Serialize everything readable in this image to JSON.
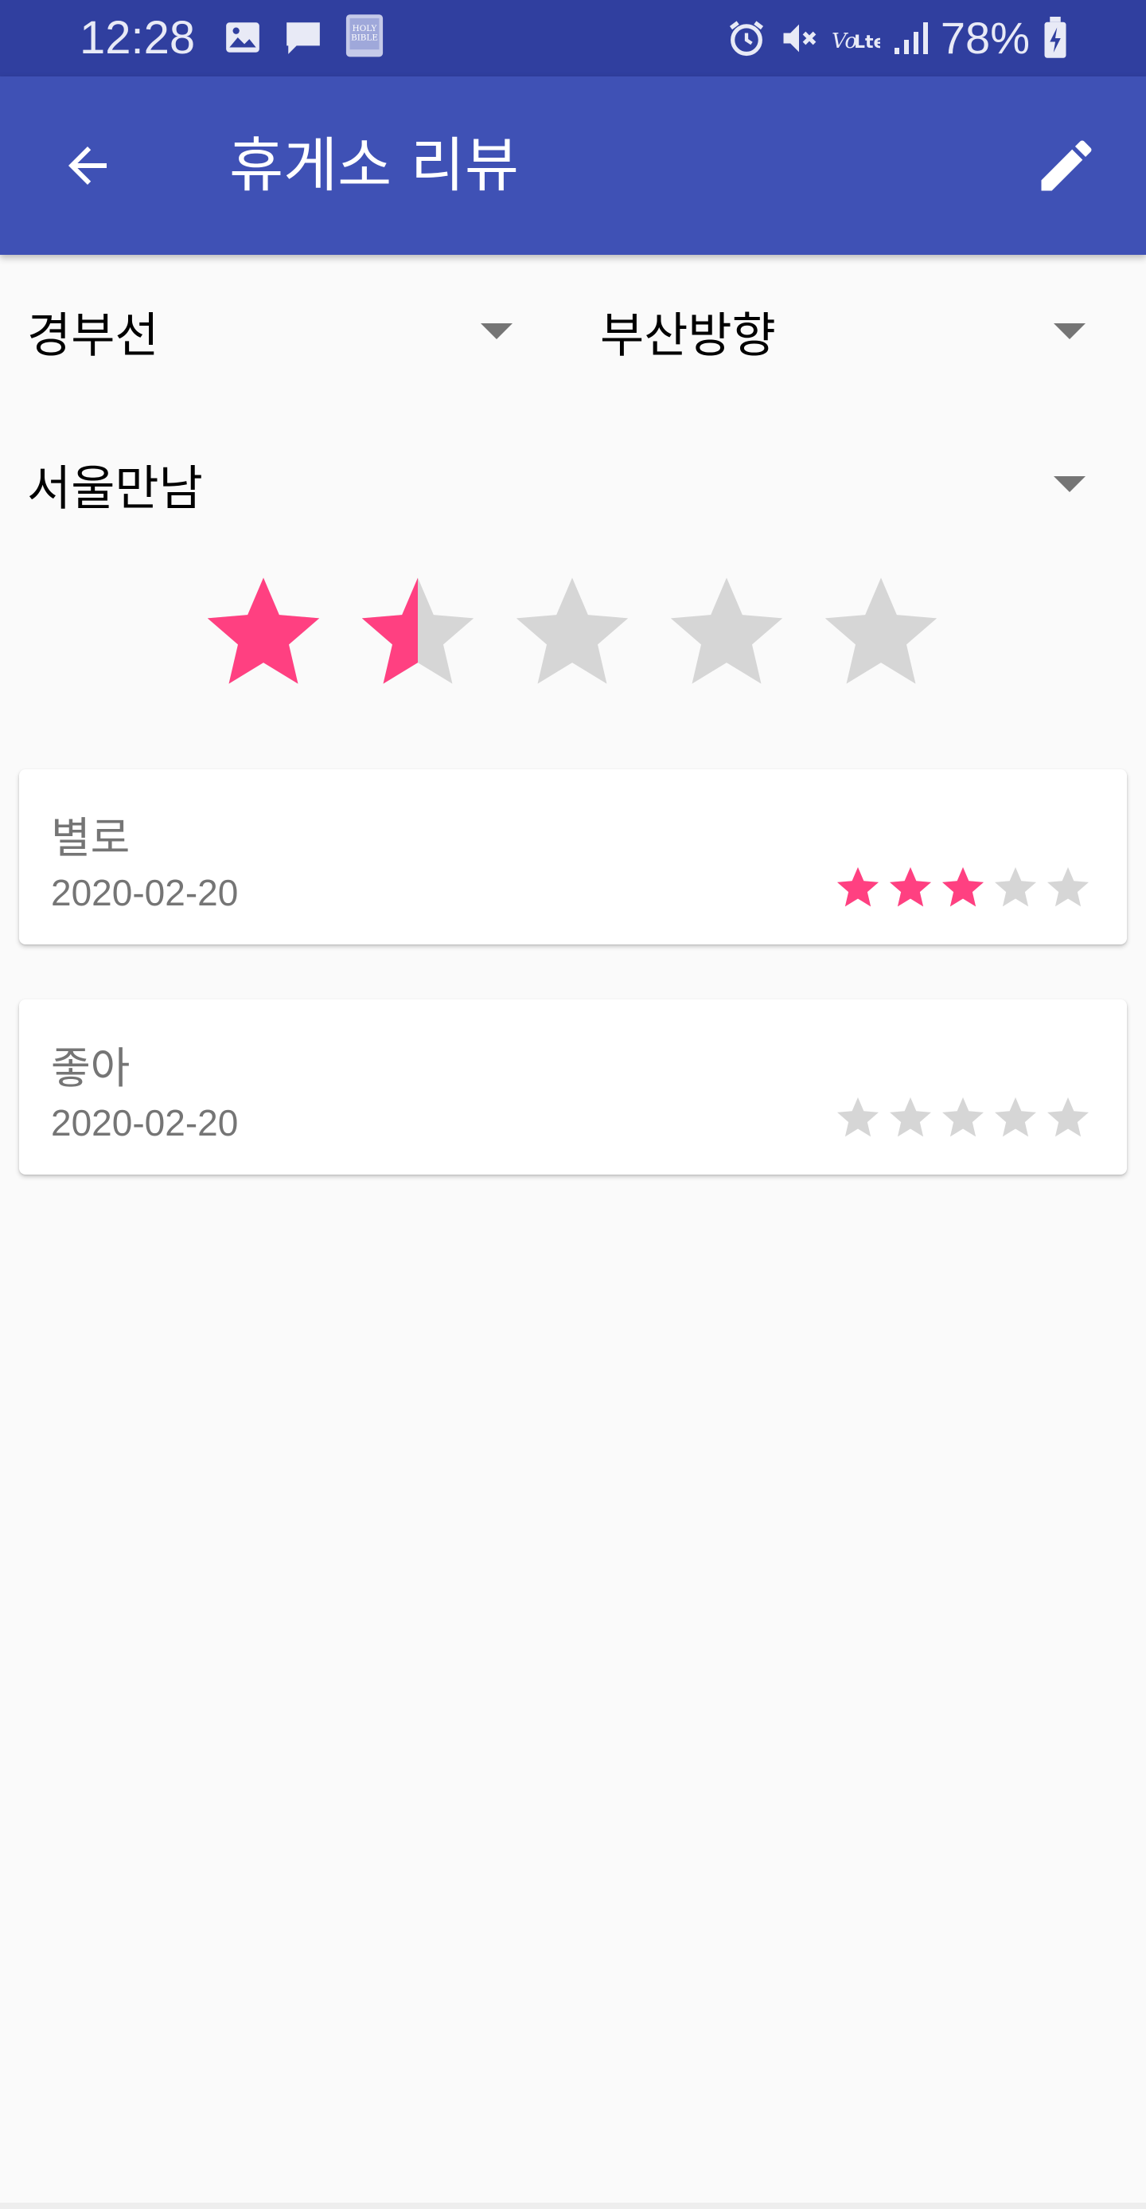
{
  "status_bar": {
    "time": "12:28",
    "battery_percent": "78%",
    "icons": [
      "image-icon",
      "message-icon",
      "holy-bible-app-icon",
      "alarm-icon",
      "mute-icon",
      "volte-icon",
      "signal-icon",
      "battery-charging-icon"
    ]
  },
  "app_bar": {
    "title": "휴게소 리뷰",
    "back_icon": "arrow-back-icon",
    "edit_icon": "pencil-edit-icon",
    "color": "#3f51b5"
  },
  "filters": {
    "route": "경부선",
    "direction": "부산방향",
    "rest_area": "서울만남"
  },
  "overall_rating": {
    "value": 1.5,
    "max": 5,
    "filled_color": "#ff4081",
    "empty_color": "#d6d6d6"
  },
  "reviews": [
    {
      "title": "별로",
      "date": "2020-02-20",
      "rating": 3,
      "max": 5
    },
    {
      "title": "좋아",
      "date": "2020-02-20",
      "rating": 0,
      "max": 5
    }
  ]
}
